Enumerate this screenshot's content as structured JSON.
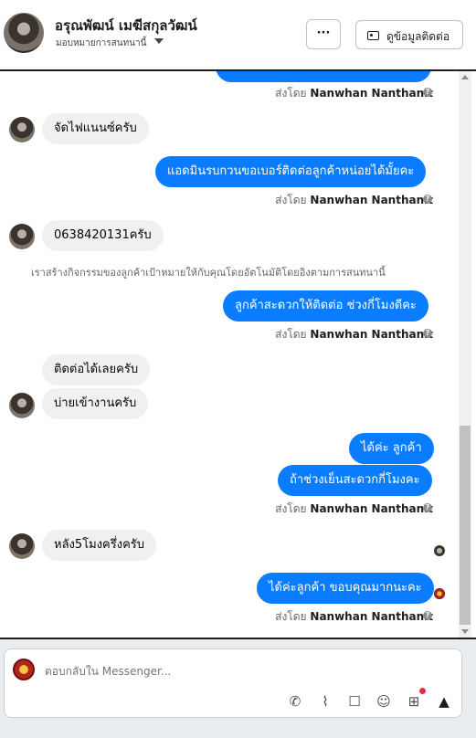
{
  "header": {
    "contact_name": "อรุณพัฒน์ เมฆีสกุลวัฒน์",
    "assigned_label": "มอบหมายการสนทนานี้",
    "more_label": "···",
    "contact_info_label": "ดูข้อมูลติดต่อ"
  },
  "messages": {
    "top_sent_by": "ส่งโดย ",
    "sender_name": "Nanwhan Nanthanit",
    "m1_in": "จัดไฟแนนซ์ครับ",
    "m2_out": "แอดมินรบกวนขอเบอร์ติดต่อลูกค้าหน่อยได้มั้ยคะ",
    "m3_in": "0638420131ครับ",
    "system_note": "เราสร้างกิจกรรมของลูกค้าเป้าหมายให้กับคุณโดยอัตโนมัติโดยอิงตามการสนทนานี้",
    "m4_out": "ลูกค้าสะดวกให้ติดต่อ ช่วงกี่โมงดีคะ",
    "m5_in": "ติดต่อได้เลยครับ",
    "m6_in": "บ่ายเข้างานครับ",
    "m7_out": "ได้ค่ะ ลูกค้า",
    "m8_out": "ถ้าช่วงเย็นสะดวกกี่โมงคะ",
    "m9_in": "หลัง5โมงครึ่งครับ",
    "m10_out": "ได้ค่ะลูกค้า ขอบคุณมากนะคะ",
    "help_icon": "?"
  },
  "composer": {
    "placeholder": "ตอบกลับใน Messenger..."
  },
  "icons": {
    "more": "ellipsis-icon",
    "contact": "contact-card-icon",
    "call": "phone-plus-icon",
    "attach": "paperclip-icon",
    "saved_reply": "chat-bubble-icon",
    "emoji": "smiley-icon",
    "order": "cart-plus-icon",
    "like": "thumbs-up-icon"
  },
  "colors": {
    "outgoing_bubble": "#0a7cff",
    "incoming_bubble": "#f0f0f0",
    "notification_dot": "#f02849"
  }
}
